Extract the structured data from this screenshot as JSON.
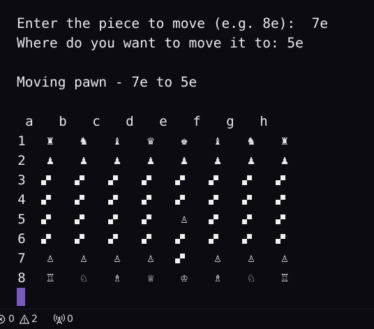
{
  "terminal": {
    "prompt_piece_label": "Enter the piece to move (e.g. 8e):  ",
    "prompt_piece_value": "7e",
    "prompt_target_label": "Where do you want to move it to: ",
    "prompt_target_value": "5e",
    "status_message": "Moving pawn - 7e to 5e"
  },
  "board": {
    "columns": [
      "a",
      "b",
      "c",
      "d",
      "e",
      "f",
      "g",
      "h"
    ],
    "rows": [
      {
        "label": "1",
        "cells": [
          "♜",
          "♞",
          "♝",
          "♛",
          "♚",
          "♝",
          "♞",
          "♜"
        ]
      },
      {
        "label": "2",
        "cells": [
          "♟",
          "♟",
          "♟",
          "♟",
          "♟",
          "♟",
          "♟",
          "♟"
        ]
      },
      {
        "label": "3",
        "cells": [
          "",
          "",
          "",
          "",
          "",
          "",
          "",
          ""
        ]
      },
      {
        "label": "4",
        "cells": [
          "",
          "",
          "",
          "",
          "",
          "",
          "",
          ""
        ]
      },
      {
        "label": "5",
        "cells": [
          "",
          "",
          "",
          "",
          "♙",
          "",
          "",
          ""
        ]
      },
      {
        "label": "6",
        "cells": [
          "",
          "",
          "",
          "",
          "",
          "",
          "",
          ""
        ]
      },
      {
        "label": "7",
        "cells": [
          "♙",
          "♙",
          "♙",
          "♙",
          "",
          "♙",
          "♙",
          "♙"
        ]
      },
      {
        "label": "8",
        "cells": [
          "♖",
          "♘",
          "♗",
          "♕",
          "♔",
          "♗",
          "♘",
          "♖"
        ]
      }
    ]
  },
  "status_bar": {
    "errors_count": "0",
    "warnings_count": "2",
    "ports_count": "0",
    "error_icon": "circle-x-icon",
    "warning_icon": "warning-triangle-icon",
    "ports_icon": "broadcast-icon"
  },
  "colors": {
    "background": "#0c0b12",
    "text": "#e9e8ec",
    "cursor": "#7b5ac0"
  }
}
